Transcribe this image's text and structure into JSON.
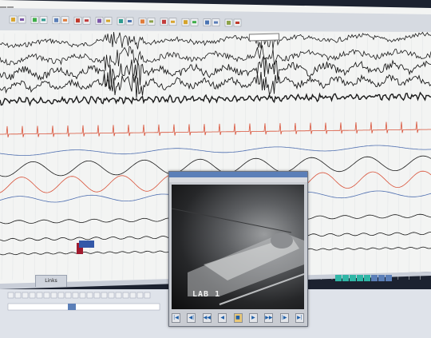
{
  "colors": {
    "background": "#f3f4f3",
    "trace": "#1a1a1a",
    "ecg_trace": "#d9533a",
    "blue_trace": "#4f6fb0",
    "toolbar": "#cfd4dd",
    "video_titlebar": "#5b7fb8"
  },
  "toolbar": {
    "tabs": [
      "",
      ""
    ],
    "icons": [
      "arrow-icon",
      "green-grid-icon",
      "zoom-icon",
      "palette-icon",
      "pen-icon",
      "chart-icon",
      "color-icon",
      "close-icon",
      "folder-icon",
      "save-icon",
      "export-icon"
    ],
    "zoom_value": ""
  },
  "video_window": {
    "title": "",
    "menu": "",
    "camera_label": "LAB 1",
    "controls": [
      "first-frame-icon",
      "step-back-icon",
      "rewind-icon",
      "back-icon",
      "play-icon",
      "forward-icon",
      "fast-forward-icon",
      "step-forward-icon",
      "last-frame-icon"
    ]
  },
  "bottom_panel": {
    "tab_label": "Links"
  },
  "event_marker": {
    "label": ""
  }
}
